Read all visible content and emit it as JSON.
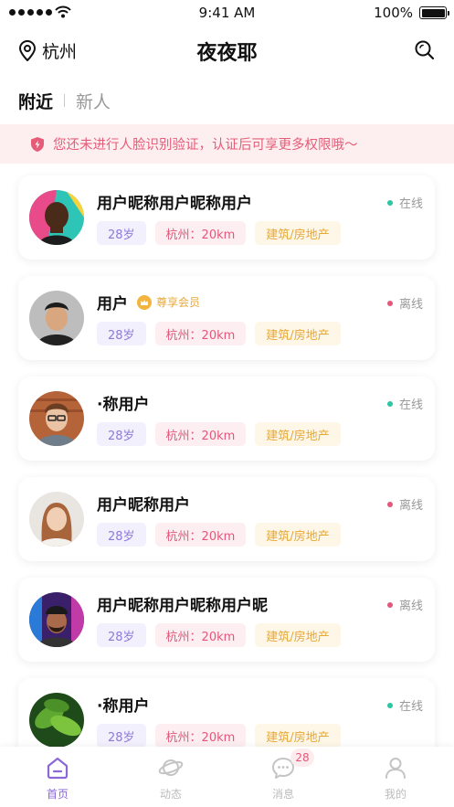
{
  "status_bar": {
    "time": "9:41 AM",
    "battery": "100%"
  },
  "header": {
    "location": "杭州",
    "title": "夜夜耶"
  },
  "tabs": [
    {
      "label": "附近"
    },
    {
      "label": "新人"
    }
  ],
  "notice": {
    "text": "您还未进行人脸识别验证，认证后可享更多权限哦～"
  },
  "users": [
    {
      "name": "用户昵称用户昵称用户",
      "status": "在线",
      "age": "28岁",
      "location": "杭州：20km",
      "job": "建筑/房地产"
    },
    {
      "name": "用户",
      "vip": "尊享会员",
      "status": "离线",
      "age": "28岁",
      "location": "杭州：20km",
      "job": "建筑/房地产"
    },
    {
      "name": "·称用户",
      "status": "在线",
      "age": "28岁",
      "location": "杭州：20km",
      "job": "建筑/房地产"
    },
    {
      "name": "用户昵称用户",
      "status": "离线",
      "age": "28岁",
      "location": "杭州：20km",
      "job": "建筑/房地产"
    },
    {
      "name": "用户昵称用户昵称用户昵",
      "status": "离线",
      "age": "28岁",
      "location": "杭州：20km",
      "job": "建筑/房地产"
    },
    {
      "name": "·称用户",
      "status": "在线",
      "age": "28岁",
      "location": "杭州：20km",
      "job": "建筑/房地产"
    }
  ],
  "tab_bar": {
    "items": [
      {
        "label": "首页",
        "icon": "home-icon"
      },
      {
        "label": "动态",
        "icon": "planet-icon"
      },
      {
        "label": "消息",
        "icon": "chat-icon",
        "badge": "28"
      },
      {
        "label": "我的",
        "icon": "profile-icon"
      }
    ]
  },
  "colors": {
    "accent": "#8a68d6",
    "online": "#2cc6a3",
    "offline": "#e2577a",
    "notice_text": "#e65c78"
  }
}
